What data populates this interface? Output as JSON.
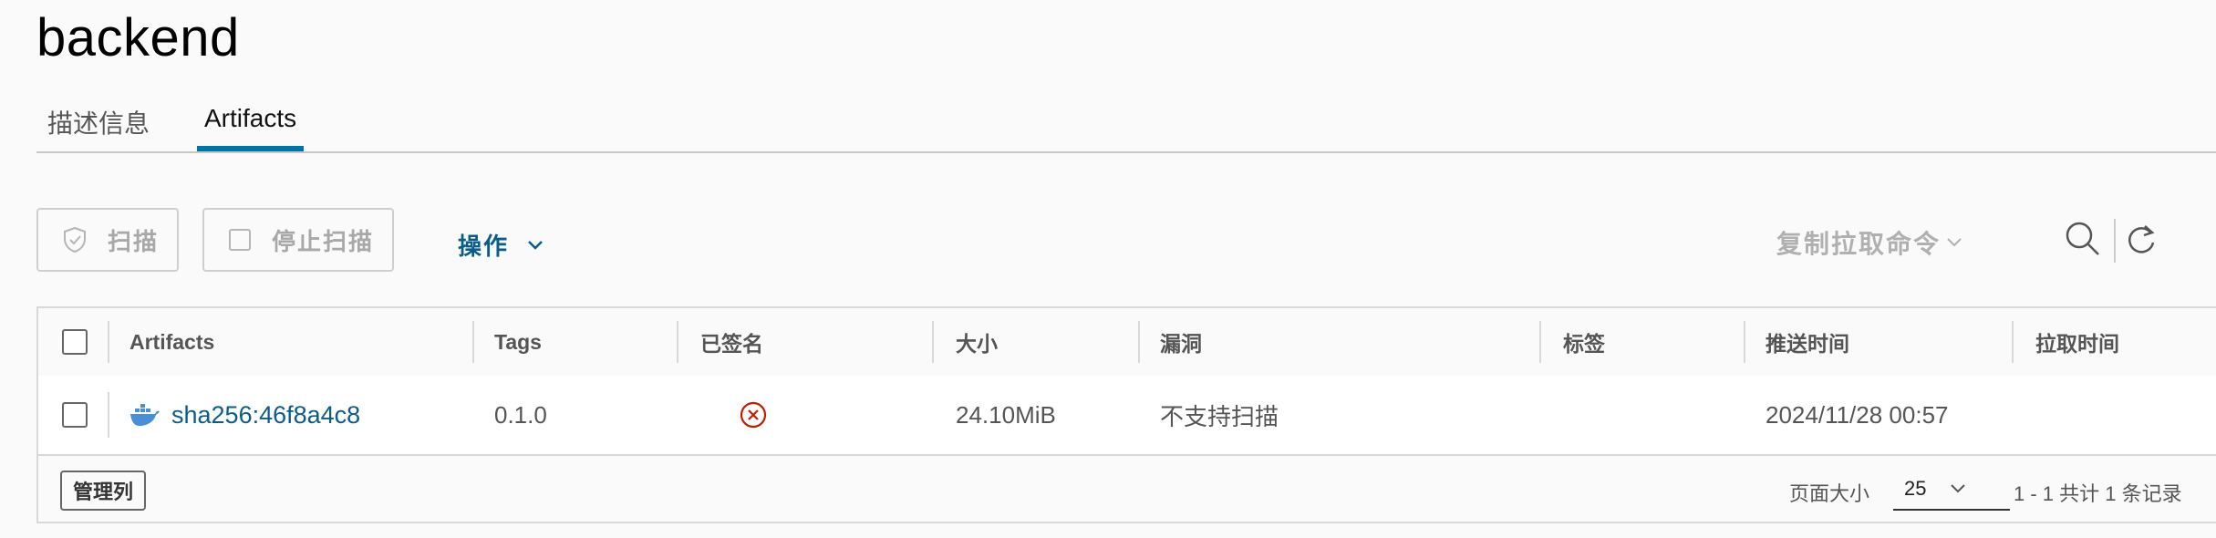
{
  "repo": {
    "title": "backend"
  },
  "tabs": [
    {
      "label": "描述信息",
      "active": false
    },
    {
      "label": "Artifacts",
      "active": true
    }
  ],
  "toolbar": {
    "scan_label": "扫描",
    "stop_scan_label": "停止扫描",
    "actions_label": "操作",
    "copy_pull_label": "复制拉取命令",
    "icons": [
      "shield-check-icon",
      "checkbox-icon",
      "chevron-down-icon",
      "search-icon",
      "refresh-icon"
    ]
  },
  "table": {
    "columns": [
      "Artifacts",
      "Tags",
      "已签名",
      "大小",
      "漏洞",
      "标签",
      "推送时间",
      "拉取时间"
    ],
    "rows": [
      {
        "artifact": "sha256:46f8a4c8",
        "artifact_icon": "docker-whale-icon",
        "tags": "0.1.0",
        "signed_icon": "not-signed-x-icon",
        "size": "24.10MiB",
        "vulnerabilities": "不支持扫描",
        "labels": "",
        "push_time": "2024/11/28 00:57",
        "pull_time": ""
      }
    ]
  },
  "footer": {
    "manage_columns_label": "管理列",
    "page_size_label": "页面大小",
    "page_size_value": "25",
    "pagination_text": "1 - 1 共计 1 条记录"
  },
  "colors": {
    "accent": "#0072a3",
    "link": "#0a5c8a",
    "danger": "#c21d00",
    "docker": "#4a8fd4"
  }
}
